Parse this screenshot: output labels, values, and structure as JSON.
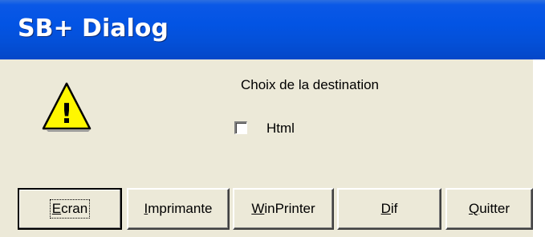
{
  "window": {
    "title": "SB+ Dialog"
  },
  "icon": {
    "name": "warning-icon",
    "glyph": "!"
  },
  "prompt": {
    "text": "Choix de la destination"
  },
  "checkbox": {
    "label": "Html",
    "checked": false
  },
  "buttons": [
    {
      "first": "E",
      "rest": "cran"
    },
    {
      "first": "I",
      "rest": "mprimante"
    },
    {
      "first": "W",
      "rest": "inPrinter"
    },
    {
      "first": "D",
      "rest": "if"
    },
    {
      "first": "Q",
      "rest": "uitter"
    }
  ],
  "colors": {
    "titlebar": "#0354e4",
    "dialog_background": "#ece9d8",
    "warning_fill": "#fff700",
    "title_text": "#ffffff"
  }
}
